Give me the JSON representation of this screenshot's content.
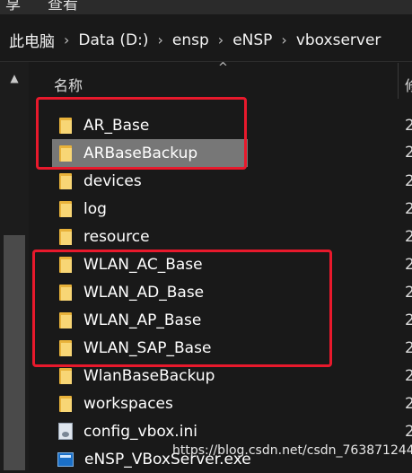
{
  "top_menu": [
    "享",
    "查看"
  ],
  "breadcrumb": [
    "此电脑",
    "Data (D:)",
    "ensp",
    "eNSP",
    "vboxserver"
  ],
  "columns": {
    "name": "名称",
    "date_partial": "修"
  },
  "files": [
    {
      "name": "AR_Base",
      "type": "folder",
      "date": "2"
    },
    {
      "name": "ARBaseBackup",
      "type": "folder",
      "date": "2",
      "selected": true
    },
    {
      "name": "devices",
      "type": "folder",
      "date": "2"
    },
    {
      "name": "log",
      "type": "folder",
      "date": "2"
    },
    {
      "name": "resource",
      "type": "folder",
      "date": "2"
    },
    {
      "name": "WLAN_AC_Base",
      "type": "folder",
      "date": "2"
    },
    {
      "name": "WLAN_AD_Base",
      "type": "folder",
      "date": "2"
    },
    {
      "name": "WLAN_AP_Base",
      "type": "folder",
      "date": "2"
    },
    {
      "name": "WLAN_SAP_Base",
      "type": "folder",
      "date": "2"
    },
    {
      "name": "WlanBaseBackup",
      "type": "folder",
      "date": "2"
    },
    {
      "name": "workspaces",
      "type": "folder",
      "date": "2"
    },
    {
      "name": "config_vbox.ini",
      "type": "ini",
      "date": "2"
    },
    {
      "name": "eNSP_VBoxServer.exe",
      "type": "exe",
      "date": ""
    }
  ],
  "watermark": "https://blog.csdn.net/csdn_763871244",
  "colors": {
    "highlight": "#e8192c",
    "selection": "#777777",
    "folder": "#f8d675"
  }
}
